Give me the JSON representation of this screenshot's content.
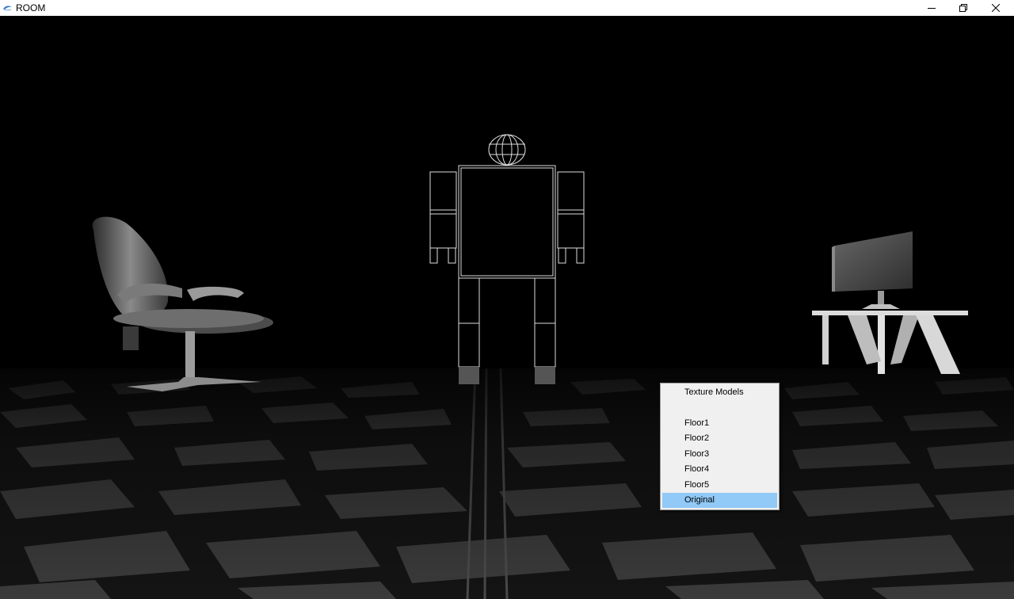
{
  "window": {
    "title": "ROOM",
    "controls": {
      "minimize_icon": "minimize-icon",
      "restore_icon": "restore-icon",
      "close_icon": "close-icon"
    }
  },
  "scene": {
    "objects": [
      "office-chair",
      "wireframe-robot",
      "tv-on-stand",
      "tiled-floor"
    ],
    "background_color": "#000000"
  },
  "context_menu": {
    "title": "Texture Models",
    "items": [
      {
        "label": "Floor1"
      },
      {
        "label": "Floor2"
      },
      {
        "label": "Floor3"
      },
      {
        "label": "Floor4"
      },
      {
        "label": "Floor5"
      },
      {
        "label": "Original",
        "selected": true
      }
    ],
    "highlight_color": "#91c9f7"
  }
}
